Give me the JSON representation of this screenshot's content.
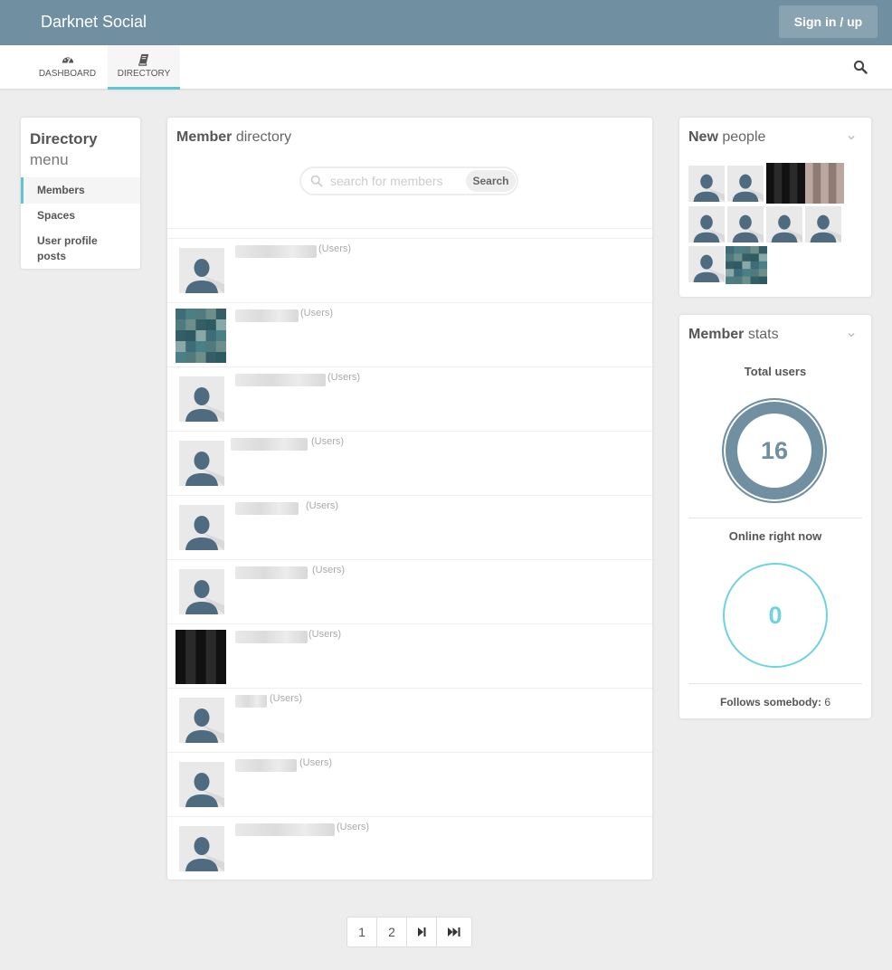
{
  "app": {
    "brand": "Darknet Social",
    "signin_label": "Sign in / up"
  },
  "nav": {
    "tabs": [
      {
        "label": "DASHBOARD",
        "icon": "dashboard-icon"
      },
      {
        "label": "DIRECTORY",
        "icon": "book-icon",
        "active": true
      }
    ],
    "search_icon": "search-icon"
  },
  "menu": {
    "title_bold": "Directory",
    "title_light": "menu",
    "items": [
      {
        "label": "Members",
        "active": true
      },
      {
        "label": "Spaces"
      },
      {
        "label": "User profile posts"
      }
    ]
  },
  "directory": {
    "title_bold": "Member",
    "title_light": "directory",
    "search_placeholder": "search for members",
    "search_button": "Search",
    "group_label": "(Users)"
  },
  "new_people": {
    "title_bold": "New",
    "title_light": "people"
  },
  "member_stats": {
    "title_bold": "Member",
    "title_light": "stats",
    "total_label": "Total users",
    "total_value": "16",
    "online_label": "Online right now",
    "online_value": "0",
    "follows_label": "Follows somebody:",
    "follows_value": "6"
  },
  "pagination": {
    "pages": [
      "1",
      "2"
    ],
    "next_icon": "next-page-icon",
    "last_icon": "last-page-icon"
  },
  "colors": {
    "header": "#708fa0",
    "accent": "#5ec5d6",
    "ring_total": "#708fa0",
    "ring_online": "#6dd3e0"
  }
}
